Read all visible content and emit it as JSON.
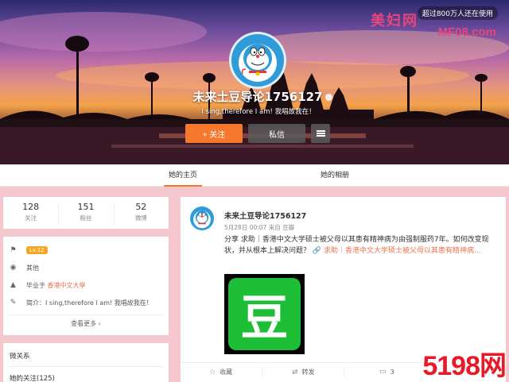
{
  "watermark": {
    "logo_text": "美妇网",
    "site": "MF08.com",
    "pill_text": "超过800万人还在使用",
    "bottom_logo": "5198网"
  },
  "profile": {
    "name": "未来土豆导论1756127",
    "bio": "I sing,therefore I am! 我唱故我在！",
    "follow_button": "+ 关注",
    "message_button": "私信"
  },
  "tabs": [
    {
      "label": "她的主页",
      "active": true
    },
    {
      "label": "她的相册",
      "active": false
    }
  ],
  "stats": [
    {
      "value": "128",
      "label": "关注"
    },
    {
      "value": "151",
      "label": "粉丝"
    },
    {
      "value": "52",
      "label": "微博"
    }
  ],
  "info": {
    "level": "Lv.12",
    "location": "其他",
    "school_prefix": "毕业于",
    "school": "香港中文大學",
    "intro_prefix": "简介：",
    "intro": "I sing,therefore I am! 我唱故我在！",
    "more": "查看更多 ›"
  },
  "relations": {
    "title": "微关系",
    "following": "她的关注(125)"
  },
  "post": {
    "author": "未来土豆导论1756127",
    "meta": "5月28日 00:07 来自 豆瓣",
    "text": "分享 求助｜香港中文大学硕士被父母以其患有精神病为由强制服药7年。如何改变现状，并从根本上解决问题？",
    "link_text": "求助｜香港中文大学硕士被父母以其患有精神病...",
    "thumb_glyph": "豆",
    "actions": {
      "collect": "收藏",
      "repost": "转发",
      "comment": "3"
    }
  },
  "colors": {
    "accent": "#f5782d",
    "link": "#eb7350",
    "douban_green": "#1dbd36"
  }
}
